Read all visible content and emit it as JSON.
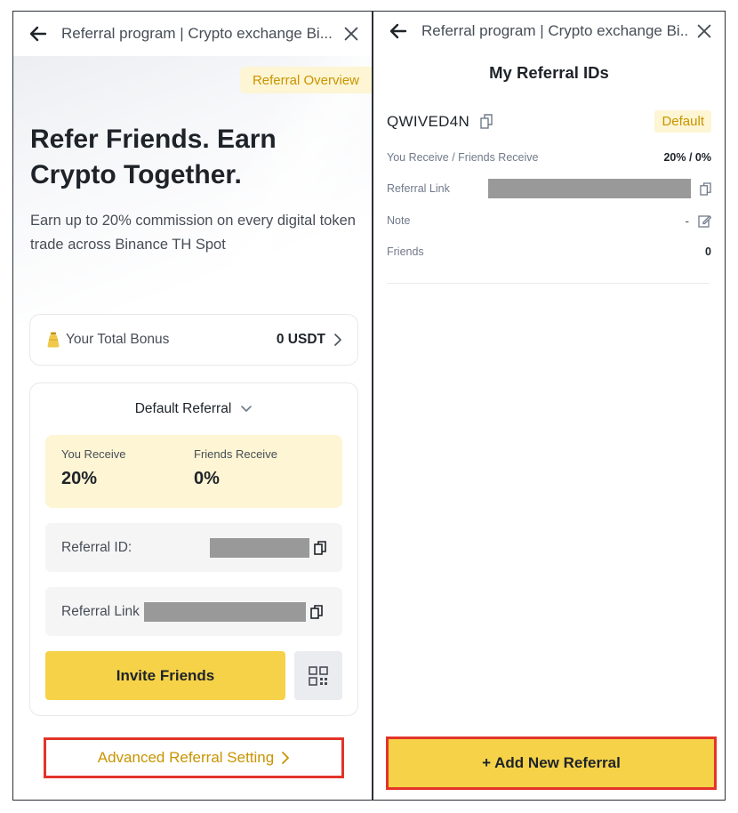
{
  "left_panel": {
    "header_title": "Referral program | Crypto exchange Bi...",
    "overview_tag": "Referral Overview",
    "hero_title": "Refer Friends. Earn Crypto Together.",
    "hero_subtitle": "Earn up to 20% commission on every digital token trade across Binance TH Spot",
    "bonus": {
      "label": "Your Total Bonus",
      "value": "0 USDT"
    },
    "referral_card": {
      "selector_label": "Default Referral",
      "you_receive_label": "You Receive",
      "you_receive_value": "20%",
      "friends_receive_label": "Friends Receive",
      "friends_receive_value": "0%",
      "referral_id_label": "Referral ID:",
      "referral_link_label": "Referral Link",
      "invite_label": "Invite Friends"
    },
    "advanced_label": "Advanced Referral Setting"
  },
  "right_panel": {
    "header_title": "Referral program | Crypto exchange Bi...",
    "page_title": "My Referral IDs",
    "referral_code": "QWIVED4N",
    "default_badge": "Default",
    "rows": {
      "receive_label": "You Receive / Friends Receive",
      "receive_value": "20% / 0%",
      "link_label": "Referral Link",
      "note_label": "Note",
      "note_value": "-",
      "friends_label": "Friends",
      "friends_value": "0"
    },
    "add_button": "+ Add New Referral"
  },
  "colors": {
    "accent_yellow": "#f6d248",
    "tag_background": "#fdf5d3",
    "tag_text": "#c99400",
    "highlight_border": "#e3342a",
    "redacted": "#999999"
  },
  "icons": [
    "back-arrow-icon",
    "close-icon",
    "money-bag-icon",
    "chevron-right-icon",
    "chevron-down-icon",
    "copy-icon",
    "qr-code-icon",
    "edit-icon"
  ]
}
